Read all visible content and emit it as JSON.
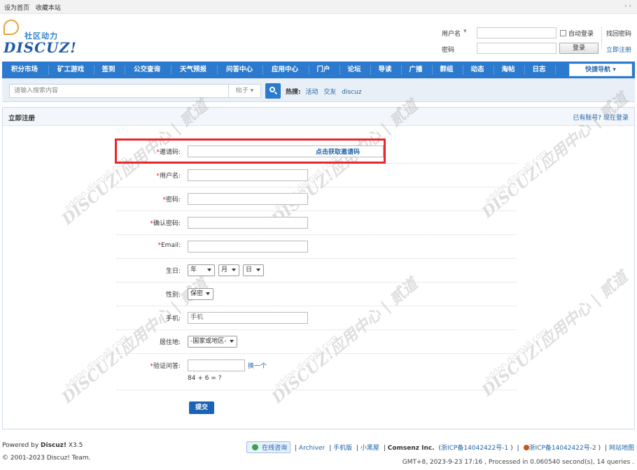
{
  "topbar": {
    "set_home": "设为首页",
    "bookmark": "收藏本站",
    "arrows": "‹ ›"
  },
  "logo": {
    "cn": "社区动力",
    "en": "DISCUZ!"
  },
  "login": {
    "username_label": "用户名",
    "password_label": "密码",
    "auto_login": "自动登录",
    "login_button": "登录",
    "find_password": "找回密码",
    "register_link": "立即注册"
  },
  "nav": {
    "items": [
      "积分市场",
      "矿工游戏",
      "签到",
      "公交查询",
      "天气预报",
      "问答中心",
      "应用中心",
      "门户",
      "论坛",
      "导读",
      "广播",
      "群组",
      "动态",
      "淘帖",
      "日志"
    ],
    "quick_nav": "快捷导航"
  },
  "search": {
    "placeholder": "请输入搜索内容",
    "type": "帖子",
    "hot_label": "热搜:",
    "hot_items": [
      "活动",
      "交友",
      "discuz"
    ]
  },
  "panel": {
    "title": "立即注册",
    "have_account": "已有账号? 现在登录"
  },
  "form": {
    "invite_label": "邀请码:",
    "invite_link": "点击获取邀请码",
    "username_label": "用户名:",
    "password_label": "密码:",
    "confirm_label": "确认密码:",
    "email_label": "Email:",
    "birthday_label": "生日:",
    "year": "年",
    "month": "月",
    "day": "日",
    "gender_label": "性别:",
    "gender_value": "保密",
    "mobile_label": "手机:",
    "mobile_value": "手机",
    "residence_label": "居住地:",
    "residence_value": "-国家或地区-",
    "captcha_label": "验证问答:",
    "captcha_refresh": "换一个",
    "captcha_question": "84 + 6 = ?",
    "required_mark": "*",
    "submit": "提交"
  },
  "watermark": {
    "main": "DISCUZ!应用中心 | 贰道",
    "sub": "addon.dismall.com"
  },
  "footer": {
    "powered_prefix": "Powered by ",
    "powered_brand": "Discuz!",
    "powered_version": " X3.5",
    "copyright": "© 2001-2023 Discuz! Team.",
    "online": "在线咨询",
    "archiver": "Archiver",
    "mobile": "手机版",
    "blackroom": "小黑屋",
    "company": "Comsenz Inc.",
    "icp1": "浙ICP备14042422号-1",
    "icp2": "浙ICP备14042422号-2",
    "sitemap": "网站地图",
    "time_info": "GMT+8, 2023-9-23 17:16 , Processed in 0.060540 second(s), 14 queries ."
  }
}
